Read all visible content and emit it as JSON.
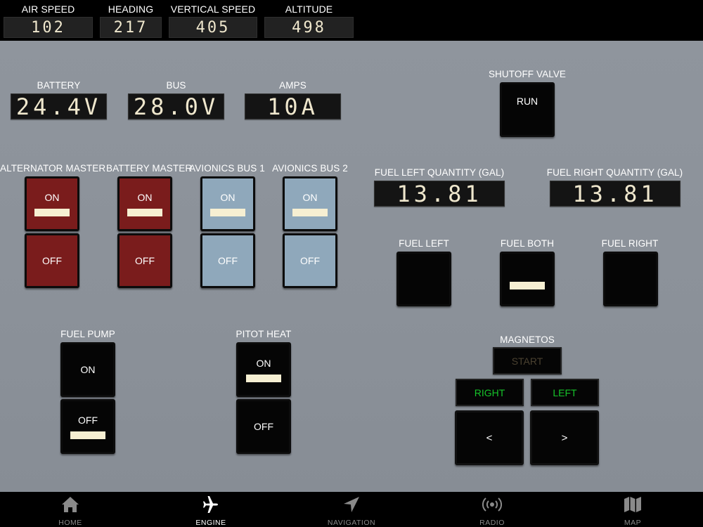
{
  "flight": {
    "air_speed": {
      "label": "AIR SPEED",
      "value": "102"
    },
    "heading": {
      "label": "HEADING",
      "value": "217"
    },
    "vertical_speed": {
      "label": "VERTICAL SPEED",
      "value": "405"
    },
    "altitude": {
      "label": "ALTITUDE",
      "value": "498"
    }
  },
  "electrical": {
    "battery": {
      "label": "BATTERY",
      "value": "24.4V"
    },
    "bus": {
      "label": "BUS",
      "value": "28.0V"
    },
    "amps": {
      "label": "AMPS",
      "value": "10A"
    }
  },
  "switches": {
    "alternator_master": {
      "label": "ALTERNATOR MASTER",
      "on": "ON",
      "off": "OFF",
      "state": "ON",
      "color": "#7a1c1c"
    },
    "battery_master": {
      "label": "BATTERY MASTER",
      "on": "ON",
      "off": "OFF",
      "state": "ON",
      "color": "#7a1c1c"
    },
    "avionics_bus_1": {
      "label": "AVIONICS BUS 1",
      "on": "ON",
      "off": "OFF",
      "state": "ON",
      "color": "#8fa8bb"
    },
    "avionics_bus_2": {
      "label": "AVIONICS BUS 2",
      "on": "ON",
      "off": "OFF",
      "state": "ON",
      "color": "#8fa8bb"
    },
    "fuel_pump": {
      "label": "FUEL PUMP",
      "on": "ON",
      "off": "OFF",
      "state": "OFF"
    },
    "pitot_heat": {
      "label": "PITOT HEAT",
      "on": "ON",
      "off": "OFF",
      "state": "ON"
    }
  },
  "shutoff_valve": {
    "label": "SHUTOFF VALVE",
    "button": "RUN"
  },
  "fuel": {
    "left_quantity": {
      "label": "FUEL LEFT QUANTITY (GAL)",
      "value": "13.81"
    },
    "right_quantity": {
      "label": "FUEL RIGHT QUANTITY (GAL)",
      "value": "13.81"
    },
    "selector": {
      "left": "FUEL LEFT",
      "both": "FUEL BOTH",
      "right": "FUEL RIGHT",
      "selected": "FUEL BOTH"
    }
  },
  "magnetos": {
    "label": "MAGNETOS",
    "start": "START",
    "right": "RIGHT",
    "left": "LEFT",
    "decrease": "<",
    "increase": ">",
    "active_color": "#16c52a",
    "inactive_color": "#4a4130"
  },
  "nav": [
    {
      "label": "HOME",
      "icon": "home-icon",
      "active": false
    },
    {
      "label": "ENGINE",
      "icon": "airplane-icon",
      "active": true
    },
    {
      "label": "NAVIGATION",
      "icon": "navigation-arrow-icon",
      "active": false
    },
    {
      "label": "RADIO",
      "icon": "radio-signal-icon",
      "active": false
    },
    {
      "label": "MAP",
      "icon": "map-icon",
      "active": false
    }
  ]
}
